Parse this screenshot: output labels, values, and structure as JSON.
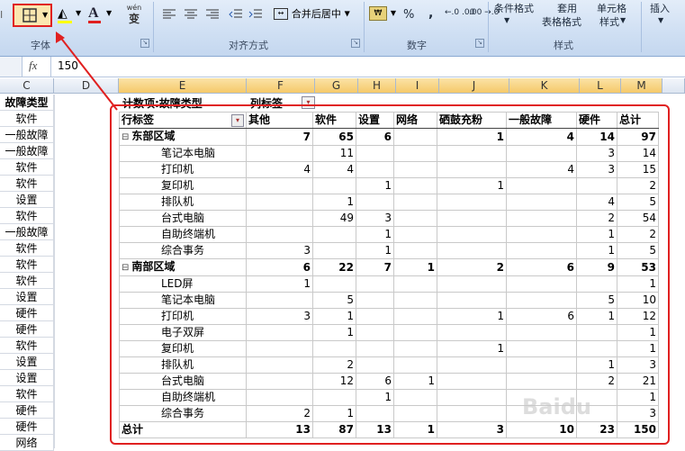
{
  "ribbon": {
    "font_group": "字体",
    "align_group": "对齐方式",
    "number_group": "数字",
    "style_group": "样式",
    "merge_center": "合并后居中",
    "percent": "%",
    "comma": ",",
    "dec_inc": "←.0 .00",
    "dec_dec": ".00 →.0",
    "cond_format": "条件格式",
    "apply_table_1": "套用",
    "apply_table_2": "表格格式",
    "cell_style_1": "单元格",
    "cell_style_2": "样式",
    "insert": "插入",
    "wen": "wén",
    "wen2": "变"
  },
  "formula_bar": {
    "fx": "fx",
    "value": "150"
  },
  "columns": [
    "C",
    "D",
    "E",
    "F",
    "G",
    "H",
    "I",
    "J",
    "K",
    "L",
    "M"
  ],
  "col_c": {
    "header": "故障类型",
    "values": [
      "软件",
      "一般故障",
      "一般故障",
      "软件",
      "软件",
      "设置",
      "软件",
      "一般故障",
      "软件",
      "软件",
      "软件",
      "设置",
      "硬件",
      "硬件",
      "软件",
      "设置",
      "设置",
      "软件",
      "硬件",
      "硬件",
      "网络"
    ]
  },
  "pivot_top": {
    "count_label": "计数项:故障类型",
    "col_label": "列标签"
  },
  "pivot": {
    "header": [
      "行标签",
      "其他",
      "软件",
      "设置",
      "网络",
      "硒鼓充粉",
      "一般故障",
      "硬件",
      "总计"
    ],
    "rows": [
      {
        "level": 0,
        "label": "东部区域",
        "vals": [
          "7",
          "65",
          "6",
          "",
          "1",
          "4",
          "14",
          "97"
        ]
      },
      {
        "level": 1,
        "label": "笔记本电脑",
        "vals": [
          "",
          "11",
          "",
          "",
          "",
          "",
          "3",
          "14"
        ]
      },
      {
        "level": 1,
        "label": "打印机",
        "vals": [
          "4",
          "4",
          "",
          "",
          "",
          "4",
          "3",
          "15"
        ]
      },
      {
        "level": 1,
        "label": "复印机",
        "vals": [
          "",
          "",
          "1",
          "",
          "1",
          "",
          "",
          "2"
        ]
      },
      {
        "level": 1,
        "label": "排队机",
        "vals": [
          "",
          "1",
          "",
          "",
          "",
          "",
          "4",
          "5"
        ]
      },
      {
        "level": 1,
        "label": "台式电脑",
        "vals": [
          "",
          "49",
          "3",
          "",
          "",
          "",
          "2",
          "54"
        ]
      },
      {
        "level": 1,
        "label": "自助终端机",
        "vals": [
          "",
          "",
          "1",
          "",
          "",
          "",
          "1",
          "2"
        ]
      },
      {
        "level": 1,
        "label": "综合事务",
        "vals": [
          "3",
          "",
          "1",
          "",
          "",
          "",
          "1",
          "5"
        ]
      },
      {
        "level": 0,
        "label": "南部区域",
        "vals": [
          "6",
          "22",
          "7",
          "1",
          "2",
          "6",
          "9",
          "53"
        ]
      },
      {
        "level": 1,
        "label": "LED屏",
        "vals": [
          "1",
          "",
          "",
          "",
          "",
          "",
          "",
          "1"
        ]
      },
      {
        "level": 1,
        "label": "笔记本电脑",
        "vals": [
          "",
          "5",
          "",
          "",
          "",
          "",
          "5",
          "10"
        ]
      },
      {
        "level": 1,
        "label": "打印机",
        "vals": [
          "3",
          "1",
          "",
          "",
          "1",
          "6",
          "1",
          "12"
        ]
      },
      {
        "level": 1,
        "label": "电子双屏",
        "vals": [
          "",
          "1",
          "",
          "",
          "",
          "",
          "",
          "1"
        ]
      },
      {
        "level": 1,
        "label": "复印机",
        "vals": [
          "",
          "",
          "",
          "",
          "1",
          "",
          "",
          "1"
        ]
      },
      {
        "level": 1,
        "label": "排队机",
        "vals": [
          "",
          "2",
          "",
          "",
          "",
          "",
          "1",
          "3"
        ]
      },
      {
        "level": 1,
        "label": "台式电脑",
        "vals": [
          "",
          "12",
          "6",
          "1",
          "",
          "",
          "2",
          "21"
        ]
      },
      {
        "level": 1,
        "label": "自助终端机",
        "vals": [
          "",
          "",
          "1",
          "",
          "",
          "",
          "",
          "1"
        ]
      },
      {
        "level": 1,
        "label": "综合事务",
        "vals": [
          "2",
          "1",
          "",
          "",
          "",
          "",
          "",
          "3"
        ]
      }
    ],
    "total": {
      "label": "总计",
      "vals": [
        "13",
        "87",
        "13",
        "1",
        "3",
        "10",
        "23",
        "150"
      ]
    }
  },
  "colors": {
    "highlight": "#e02020",
    "header_sel": "#f5c96a"
  }
}
